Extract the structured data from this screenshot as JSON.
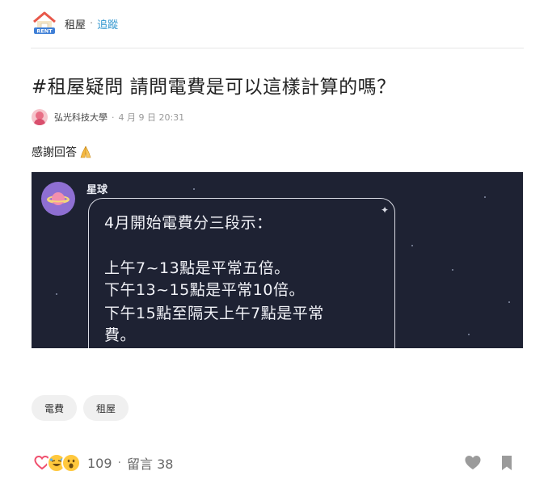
{
  "board": {
    "name": "租屋",
    "follow_label": "追蹤",
    "icon": "rent-house-icon",
    "icon_text": "RENT"
  },
  "post": {
    "title": "#租屋疑問 請問電費是可以這樣計算的嗎？",
    "school": "弘光科技大學",
    "date": "4 月 9 日 20:31",
    "body": "感謝回答",
    "image": {
      "username": "星球",
      "lines": [
        "4月開始電費分三段示：",
        "上午7~13點是平常五倍。",
        "下午13~15點是平常10倍。",
        "下午15點至隔天上午7點是平常",
        "費。"
      ]
    }
  },
  "tags": [
    "電費",
    "租屋"
  ],
  "footer": {
    "reaction_count": "109",
    "comments_label": "留言 38",
    "reaction_icons": [
      "heart-icon",
      "laugh-emoji-icon",
      "wow-emoji-icon"
    ]
  },
  "colors": {
    "accent": "#3397cf",
    "image_bg": "#1e2233",
    "planet": "#8e6fd2"
  }
}
